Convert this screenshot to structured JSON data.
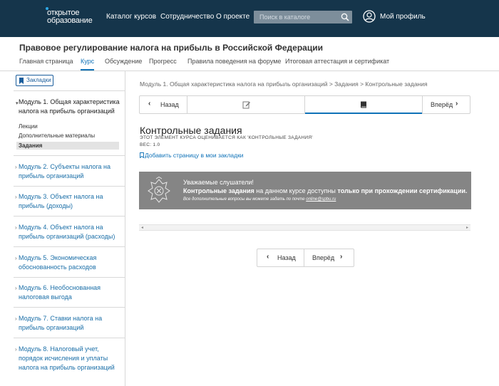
{
  "header": {
    "logo_line1": "открытое",
    "logo_line2": "образование",
    "nav": [
      "Каталог курсов",
      "Сотрудничество",
      "О проекте"
    ],
    "search_placeholder": "Поиск в каталоге",
    "search_icon": "search-icon",
    "profile_icon": "user-circle-icon",
    "profile_label": "Мой профиль",
    "bg_color": "#15354b"
  },
  "course": {
    "title": "Правовое регулирование налога на прибыль в Российской Федерации",
    "tabs": [
      "Главная страница",
      "Курс",
      "Обсуждение",
      "Прогресс",
      "Правила поведения на форуме",
      "Итоговая аттестация и сертификат"
    ],
    "active_tab": "Курс",
    "accent_color": "#0f72b8"
  },
  "sidebar": {
    "bookmarks_label": "Закладки",
    "current_module": "Модуль 1. Общая характеристика налога на прибыль организаций",
    "subsections": [
      "Лекции",
      "Дополнительные материалы",
      "Задания"
    ],
    "active_subsection": "Задания",
    "modules": [
      "Модуль 2. Субъекты налога на прибыль организаций",
      "Модуль 3. Объект налога на прибыль (доходы)",
      "Модуль 4. Объект налога на прибыль организаций (расходы)",
      "Модуль 5. Экономическая обоснованность расходов",
      "Модуль 6. Необоснованная налоговая выгода",
      "Модуль 7. Ставки налога на прибыль организаций",
      "Модуль 8. Налоговый учет, порядок исчисления и уплаты налога на прибыль организаций"
    ]
  },
  "main": {
    "breadcrumb": "Модуль 1. Общая характеристика налога на прибыль организаций > Задания > Контрольные задания",
    "prev_label": "Назад",
    "next_label": "Вперёд",
    "seq_icons": [
      "edit-icon",
      "book-icon"
    ],
    "active_seq_index": 1,
    "unit_title": "Контрольные задания",
    "grade_note": "ЭТОТ ЭЛЕМЕНТ КУРСА ОЦЕНИВАЕТСЯ КАК 'КОНТРОЛЬНЫЕ ЗАДАНИЯ'",
    "weight": "ВЕС: 1.0",
    "add_bookmark": "Добавить страницу в мои закладки",
    "notice": {
      "greeting": "Уважаемые слушатели!",
      "bold1": "Контрольные задания",
      "middle": " на данном курсе доступны ",
      "bold2": "только при прохождении сертификации.",
      "small_text": "Все дополнительные вопросы вы можете задать по почте ",
      "email": "online@spbu.ru",
      "bg_color": "#858585"
    },
    "bottom_prev": "Назад",
    "bottom_next": "Вперёд"
  }
}
